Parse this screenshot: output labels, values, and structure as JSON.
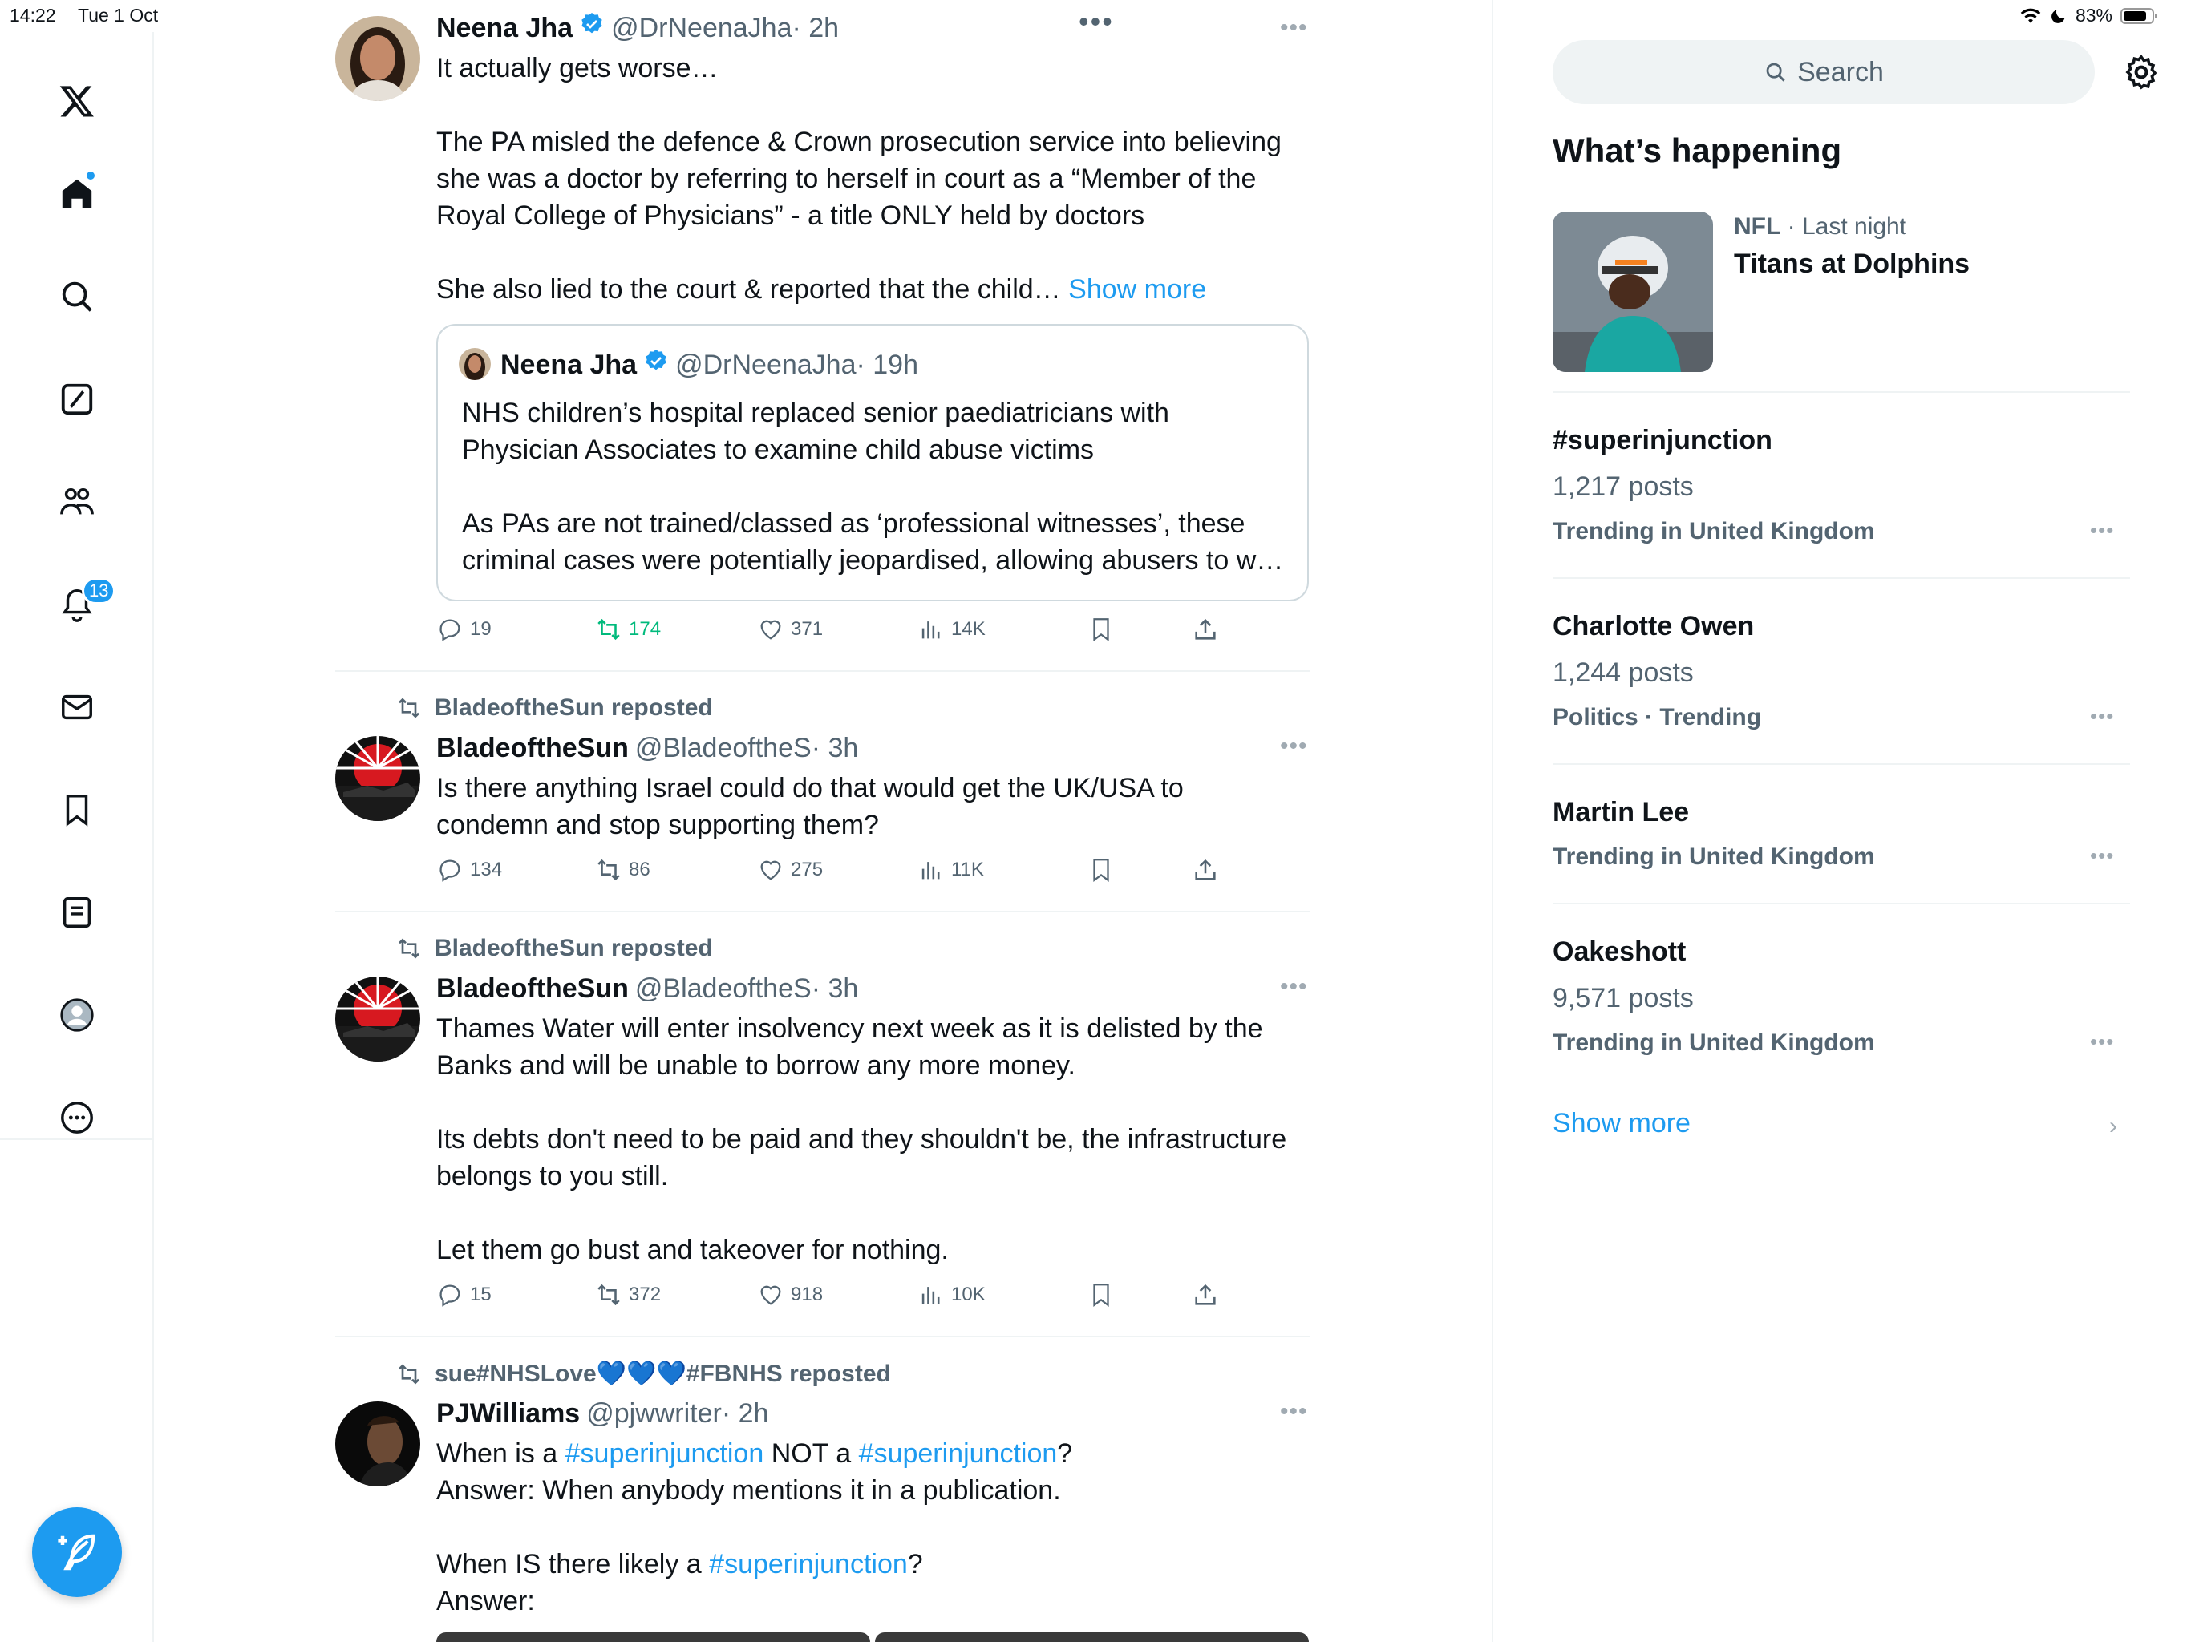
{
  "status": {
    "time": "14:22",
    "date": "Tue 1 Oct",
    "battery": "83%"
  },
  "nav": {
    "notifications_badge": "13"
  },
  "feed": {
    "tweets": [
      {
        "name": "Neena Jha",
        "handle": "@DrNeenaJha",
        "time": "· 2h",
        "text": "It actually gets worse…\n\nThe PA misled the defence & Crown prosecution service into believing\nshe was a doctor by referring to herself in court as a “Member of the\nRoyal College of Physicians” - a title ONLY held by doctors\n\nShe also lied to the court & reported that the child… ",
        "show_more": "Show more",
        "quote": {
          "name": "Neena Jha",
          "handle": "@DrNeenaJha",
          "time": "· 19h",
          "text": "NHS children’s hospital replaced senior paediatricians with\nPhysician Associates to examine child abuse victims\n\nAs PAs are not trained/classed as ‘professional witnesses’, these\ncriminal cases were potentially jeopardised, allowing abusers to w…"
        },
        "replies": "19",
        "reposts": "174",
        "likes": "371",
        "views": "14K"
      },
      {
        "reposted_by": "BladeoftheSun reposted",
        "name": "BladeoftheSun",
        "handle": "@BladeoftheS",
        "time": "· 3h",
        "text": "Is there anything Israel could do that would get the UK/USA to\ncondemn and stop supporting them?",
        "replies": "134",
        "reposts": "86",
        "likes": "275",
        "views": "11K"
      },
      {
        "reposted_by": "BladeoftheSun reposted",
        "name": "BladeoftheSun",
        "handle": "@BladeoftheS",
        "time": "· 3h",
        "text": "Thames Water will enter insolvency next week as it is delisted by the\nBanks and will be unable to borrow any more money.\n\nIts debts don't need to be paid and they shouldn't be, the infrastructure\nbelongs to you still.\n\nLet them go bust and takeover for nothing.",
        "replies": "15",
        "reposts": "372",
        "likes": "918",
        "views": "10K"
      },
      {
        "reposted_by": "sue#NHSLove💙💙💙#FBNHS reposted",
        "name": "PJWilliams",
        "handle": "@pjwwriter",
        "time": "· 2h",
        "line1_a": "When is a ",
        "hashtag": "#superinjunction",
        "line1_b": " NOT a ",
        "line1_c": "?",
        "line2": "Answer: When anybody mentions it in a publication.",
        "line3_a": "When IS there likely a ",
        "line3_b": "?",
        "line4": "Answer:"
      }
    ]
  },
  "sidebar": {
    "search_placeholder": "Search",
    "title": "What’s happening",
    "featured": {
      "category": "NFL",
      "when": " · Last night",
      "title": "Titans at Dolphins"
    },
    "trends": [
      {
        "title": "#superinjunction",
        "posts": "1,217 posts",
        "context": "Trending in United Kingdom"
      },
      {
        "title": "Charlotte Owen",
        "posts": "1,244 posts",
        "context": "Politics · Trending"
      },
      {
        "title": "Martin Lee",
        "context": "Trending in United Kingdom"
      },
      {
        "title": "Oakeshott",
        "posts": "9,571 posts",
        "context": "Trending in United Kingdom"
      }
    ],
    "show_more": "Show more"
  },
  "colors": {
    "accent": "#1d9bf0",
    "repost_active": "#00ba7c",
    "muted": "#536471"
  }
}
